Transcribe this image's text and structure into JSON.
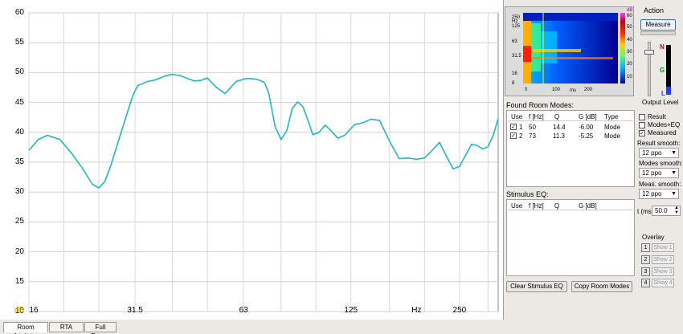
{
  "chart": {
    "y_ticks": [
      "60",
      "55",
      "50",
      "45",
      "40",
      "35",
      "30",
      "25",
      "20",
      "15",
      "10"
    ],
    "x_ticks": [
      "16",
      "31.5",
      "63",
      "125",
      "Hz",
      "250"
    ],
    "y_unit": "dB"
  },
  "chart_data": {
    "type": "line",
    "xlabel": "Hz",
    "ylabel": "dB",
    "ylim": [
      10,
      60
    ],
    "xlim": [
      16,
      320
    ],
    "x_scale": "log",
    "grid": true,
    "series": [
      {
        "color": "#20b8c0",
        "x": [
          16,
          17,
          18,
          19.5,
          21,
          22.5,
          24,
          25,
          26,
          27,
          29,
          31,
          32,
          34,
          36,
          38,
          40,
          42,
          44,
          46,
          48,
          50,
          53,
          56,
          60,
          64,
          66,
          68,
          70,
          72,
          74,
          77,
          80,
          83,
          86,
          89,
          92,
          95,
          98,
          102,
          106,
          110,
          115,
          120,
          128,
          135,
          142,
          150,
          160,
          170,
          180,
          190,
          200,
          210,
          220,
          230,
          240,
          250,
          260,
          270,
          280,
          290,
          300,
          310,
          320
        ],
        "y": [
          37,
          38.8,
          39.5,
          38.8,
          36.5,
          34,
          31.3,
          30.7,
          31.8,
          34.5,
          40.5,
          46,
          47.8,
          48.5,
          48.8,
          49.4,
          49.7,
          49.5,
          49,
          48.6,
          48.7,
          49.1,
          47.5,
          46.5,
          48.5,
          49,
          49,
          48.9,
          48.7,
          48.3,
          46.5,
          41,
          38.8,
          40.3,
          44,
          45.1,
          44.3,
          42,
          39.6,
          40,
          41.2,
          40.3,
          39,
          39.5,
          41.3,
          41.6,
          42.2,
          42,
          38.5,
          35.6,
          35.7,
          35.5,
          35.7,
          37,
          38.3,
          36,
          33.9,
          34.3,
          36.2,
          38,
          37.8,
          37.2,
          37.6,
          39.5,
          42.3
        ]
      }
    ]
  },
  "spectrogram": {
    "y_ticks": [
      "250",
      "125",
      "63",
      "31.5",
      "16",
      "8"
    ],
    "y_unit": "Hz",
    "x_ticks": [
      "0",
      "100",
      "200"
    ],
    "x_unit": "ms",
    "scale": [
      "dB",
      "60",
      "50",
      "40",
      "30",
      "20",
      "10"
    ]
  },
  "action": {
    "title": "Action",
    "measure_label": "Measure",
    "level_label": "Output Level",
    "meter_letters": [
      "N",
      "G",
      "L"
    ]
  },
  "modes": {
    "title": "Found Room Modes:",
    "headers": [
      "Use",
      "f [Hz]",
      "Q",
      "G [dB]",
      "Type"
    ],
    "rows": [
      {
        "use": "1",
        "f": "50",
        "q": "14.4",
        "g": "-6.00",
        "type": "Mode"
      },
      {
        "use": "2",
        "f": "73",
        "q": "11.3",
        "g": "-5.25",
        "type": "Mode"
      }
    ]
  },
  "checks": {
    "result": "Result",
    "modes_eq": "Modes+EQ",
    "measured": "Measured"
  },
  "smooth": {
    "result_label": "Result smooth:",
    "result_value": "12 ppo",
    "modes_label": "Modes smooth:",
    "modes_value": "12 ppo",
    "meas_label": "Meas. smooth:",
    "meas_value": "12 ppo",
    "t_label": "t (ms)",
    "t_value": "50.0"
  },
  "stimulus": {
    "title": "Stimulus EQ:",
    "headers": [
      "Use",
      "f [Hz]",
      "Q",
      "G [dB]"
    ]
  },
  "buttons": {
    "clear_eq": "Clear Stimulus EQ",
    "copy_modes": "Copy Room Modes"
  },
  "overlay": {
    "title": "Overlay",
    "items": [
      {
        "num": "1",
        "show": "Show 1"
      },
      {
        "num": "2",
        "show": "Show 2"
      },
      {
        "num": "3",
        "show": "Show 3"
      },
      {
        "num": "4",
        "show": "Show 4"
      }
    ]
  },
  "tabs": [
    "Room Analyzer",
    "RTA",
    "Full Range"
  ]
}
